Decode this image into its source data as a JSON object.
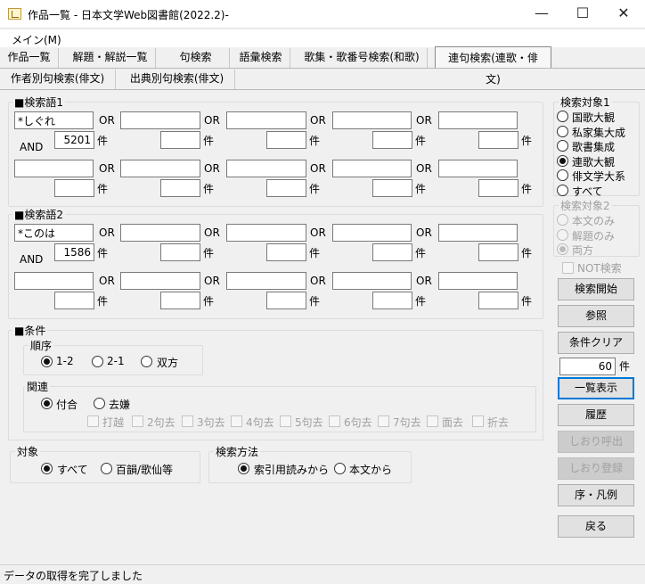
{
  "window": {
    "title": "作品一覧 - 日本文学Web図書館(2022.2)-",
    "minimize": "—",
    "maximize": "☐",
    "close": "✕"
  },
  "menu": {
    "main": "メイン(M)"
  },
  "tabs_row1": [
    "作品一覧",
    "解題・解説一覧",
    "句検索",
    "語彙検索",
    "歌集・歌番号検索(和歌)",
    "連句検索(連歌・俳文)"
  ],
  "tabs_row2": [
    "作者別句検索(俳文)",
    "出典別句検索(俳文)"
  ],
  "search1": {
    "title": "■検索語1",
    "or": "OR",
    "and": "AND",
    "unit": "件",
    "row1": [
      "*しぐれ",
      "",
      "",
      "",
      ""
    ],
    "row1_counts": [
      "5201",
      "",
      "",
      "",
      ""
    ],
    "row2": [
      "",
      "",
      "",
      "",
      ""
    ],
    "row2_counts": [
      "",
      "",
      "",
      "",
      ""
    ]
  },
  "search2": {
    "title": "■検索語2",
    "or": "OR",
    "and": "AND",
    "unit": "件",
    "row1": [
      "*このは",
      "",
      "",
      "",
      ""
    ],
    "row1_counts": [
      "1586",
      "",
      "",
      "",
      ""
    ],
    "row2": [
      "",
      "",
      "",
      "",
      ""
    ],
    "row2_counts": [
      "",
      "",
      "",
      "",
      ""
    ]
  },
  "conditions": {
    "title": "■条件",
    "order": {
      "label": "順序",
      "options": [
        "1-2",
        "2-1",
        "双方"
      ],
      "selected": "1-2"
    },
    "relation": {
      "label": "関連",
      "options": [
        "付合",
        "去嫌"
      ],
      "selected": "付合",
      "checks": [
        "打越",
        "2句去",
        "3句去",
        "4句去",
        "5句去",
        "6句去",
        "7句去",
        "面去",
        "折去"
      ]
    }
  },
  "target": {
    "label": "対象",
    "options": [
      "すべて",
      "百韻/歌仙等"
    ],
    "selected": "すべて"
  },
  "method": {
    "label": "検索方法",
    "options": [
      "索引用読みから",
      "本文から"
    ],
    "selected": "索引用読みから"
  },
  "scope1": {
    "label": "検索対象1",
    "options": [
      "国歌大観",
      "私家集大成",
      "歌書集成",
      "連歌大観",
      "俳文学大系",
      "すべて"
    ],
    "selected": "連歌大観"
  },
  "scope2": {
    "label": "検索対象2",
    "options": [
      "本文のみ",
      "解題のみ",
      "両方"
    ],
    "selected": "両方"
  },
  "not_search": "NOT検索",
  "buttons": {
    "start": "検索開始",
    "ref": "参照",
    "clear": "条件クリア",
    "limit": "60",
    "limit_unit": "件",
    "list": "一覧表示",
    "history": "履歴",
    "bm_call": "しおり呼出",
    "bm_save": "しおり登録",
    "preface": "序・凡例",
    "back": "戻る"
  },
  "status": "データの取得を完了しました"
}
